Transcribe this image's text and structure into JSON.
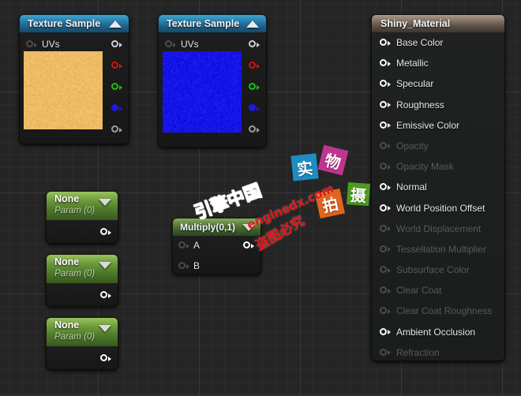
{
  "editor": {
    "name": "material-graph-editor",
    "background_color": "#252525",
    "grid_color": "#3a3a3a"
  },
  "nodes": {
    "texture_sample_1": {
      "title": "Texture Sample",
      "collapse_icon": "caret-up-icon",
      "header_color": "#2a7fae",
      "preview_color": "#efbc66",
      "inputs": [
        {
          "label": "UVs",
          "enabled": false
        }
      ],
      "outputs": [
        {
          "label": "",
          "channel": "RGB",
          "color": "#cfd3d6"
        },
        {
          "label": "",
          "channel": "R",
          "color": "#d11313"
        },
        {
          "label": "",
          "channel": "G",
          "color": "#17c017"
        },
        {
          "label": "",
          "channel": "B",
          "color": "#1a1ae0"
        },
        {
          "label": "",
          "channel": "A",
          "color": "#9aa0a3"
        }
      ]
    },
    "texture_sample_2": {
      "title": "Texture Sample",
      "collapse_icon": "caret-up-icon",
      "header_color": "#2a7fae",
      "preview_color": "#1515e8",
      "inputs": [
        {
          "label": "UVs",
          "enabled": false
        }
      ],
      "outputs": [
        {
          "label": "",
          "channel": "RGB",
          "color": "#cfd3d6"
        },
        {
          "label": "",
          "channel": "R",
          "color": "#d11313"
        },
        {
          "label": "",
          "channel": "G",
          "color": "#17c017"
        },
        {
          "label": "",
          "channel": "B",
          "color": "#1a1ae0"
        },
        {
          "label": "",
          "channel": "A",
          "color": "#9aa0a3"
        }
      ]
    },
    "param_1": {
      "name": "None",
      "subtitle": "Param (0)",
      "dropdown_icon": "caret-down-icon"
    },
    "param_2": {
      "name": "None",
      "subtitle": "Param (0)",
      "dropdown_icon": "caret-down-icon"
    },
    "param_3": {
      "name": "None",
      "subtitle": "Param (0)",
      "dropdown_icon": "caret-down-icon"
    },
    "multiply": {
      "title": "Multiply(0,1)",
      "dropdown_icon": "caret-down-icon",
      "inputs": [
        {
          "label": "A"
        },
        {
          "label": "B"
        }
      ],
      "outputs": [
        {
          "label": ""
        }
      ]
    },
    "material": {
      "title": "Shiny_Material",
      "header_color": "#8a7a6d",
      "pins": [
        {
          "label": "Base Color",
          "enabled": true
        },
        {
          "label": "Metallic",
          "enabled": true
        },
        {
          "label": "Specular",
          "enabled": true
        },
        {
          "label": "Roughness",
          "enabled": true
        },
        {
          "label": "Emissive Color",
          "enabled": true
        },
        {
          "label": "Opacity",
          "enabled": false
        },
        {
          "label": "Opacity Mask",
          "enabled": false
        },
        {
          "label": "Normal",
          "enabled": true
        },
        {
          "label": "World Position Offset",
          "enabled": true
        },
        {
          "label": "World Displacement",
          "enabled": false
        },
        {
          "label": "Tessellation Multiplier",
          "enabled": false
        },
        {
          "label": "Subsurface Color",
          "enabled": false
        },
        {
          "label": "Clear Coat",
          "enabled": false
        },
        {
          "label": "Clear Coat Roughness",
          "enabled": false
        },
        {
          "label": "Ambient Occlusion",
          "enabled": true
        },
        {
          "label": "Refraction",
          "enabled": false
        }
      ]
    }
  },
  "watermarks": {
    "brand_cn": "引擎中国",
    "brand_url": "enginedx.com",
    "notice": "盗图必究",
    "tiles": [
      {
        "char": "实",
        "color": "#1d8dc4"
      },
      {
        "char": "物",
        "color": "#c0358f"
      },
      {
        "char": "拍",
        "color": "#e2651f"
      },
      {
        "char": "摄",
        "color": "#4e9c1e"
      }
    ]
  }
}
